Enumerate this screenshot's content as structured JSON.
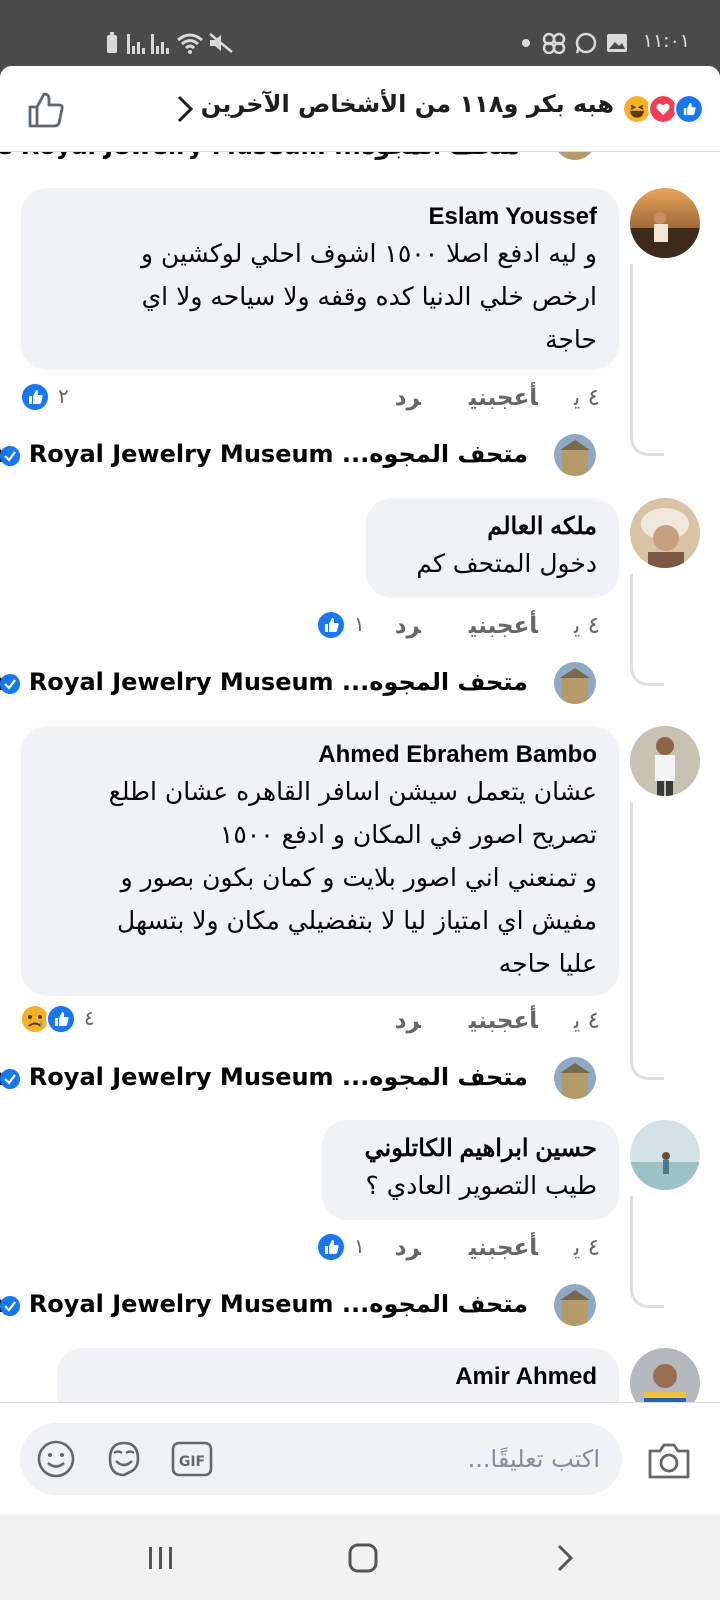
{
  "status_bar": {
    "time": "١١:٠١"
  },
  "header": {
    "title": "هبه بكر و١١٨ من الأشخاص الآخرين",
    "reactions": [
      "like-icon",
      "love-icon",
      "haha-icon"
    ]
  },
  "colors": {
    "like_blue": "#1877f2",
    "love_red": "#f33e58",
    "haha_yellow": "#f7b125",
    "bubble_bg": "#f0f2f5",
    "meta_gray": "#65676b"
  },
  "reply_name": "متحف المجوه... The Royal Jewelry Museum",
  "actions": {
    "time": "٤ ي",
    "like": "أعجبني",
    "reply": "رد"
  },
  "comments": [
    {
      "name": "Eslam Youssef",
      "lines": [
        "و ليه ادفع اصلا ١٥٠٠ اشوف احلي لوكشين و",
        "ارخص خلي الدنيا كده وقفه ولا سياحه ولا اي",
        "حاجة"
      ],
      "reaction_count": "٢"
    },
    {
      "name": "ملكه العالم",
      "lines": [
        "دخول المتحف كم"
      ],
      "reaction_count": "١"
    },
    {
      "name": "Ahmed Ebrahem Bambo",
      "lines": [
        "عشان يتعمل سيشن اسافر القاهره عشان اطلع",
        "تصريح اصور في المكان و ادفع ١٥٠٠",
        "و تمنعني اني اصور بلايت و كمان بكون بصور و",
        "مفيش اي امتياز ليا لا بتفضيلي مكان ولا بتسهل",
        "عليا حاجه"
      ],
      "reaction_count": "٤"
    },
    {
      "name": "حسين ابراهيم الكاتلوني",
      "lines": [
        "طيب التصوير العادي ؟"
      ],
      "reaction_count": "١"
    },
    {
      "name": "Amir Ahmed",
      "lines": []
    }
  ],
  "composer": {
    "placeholder": "اكتب تعليقًا..."
  }
}
